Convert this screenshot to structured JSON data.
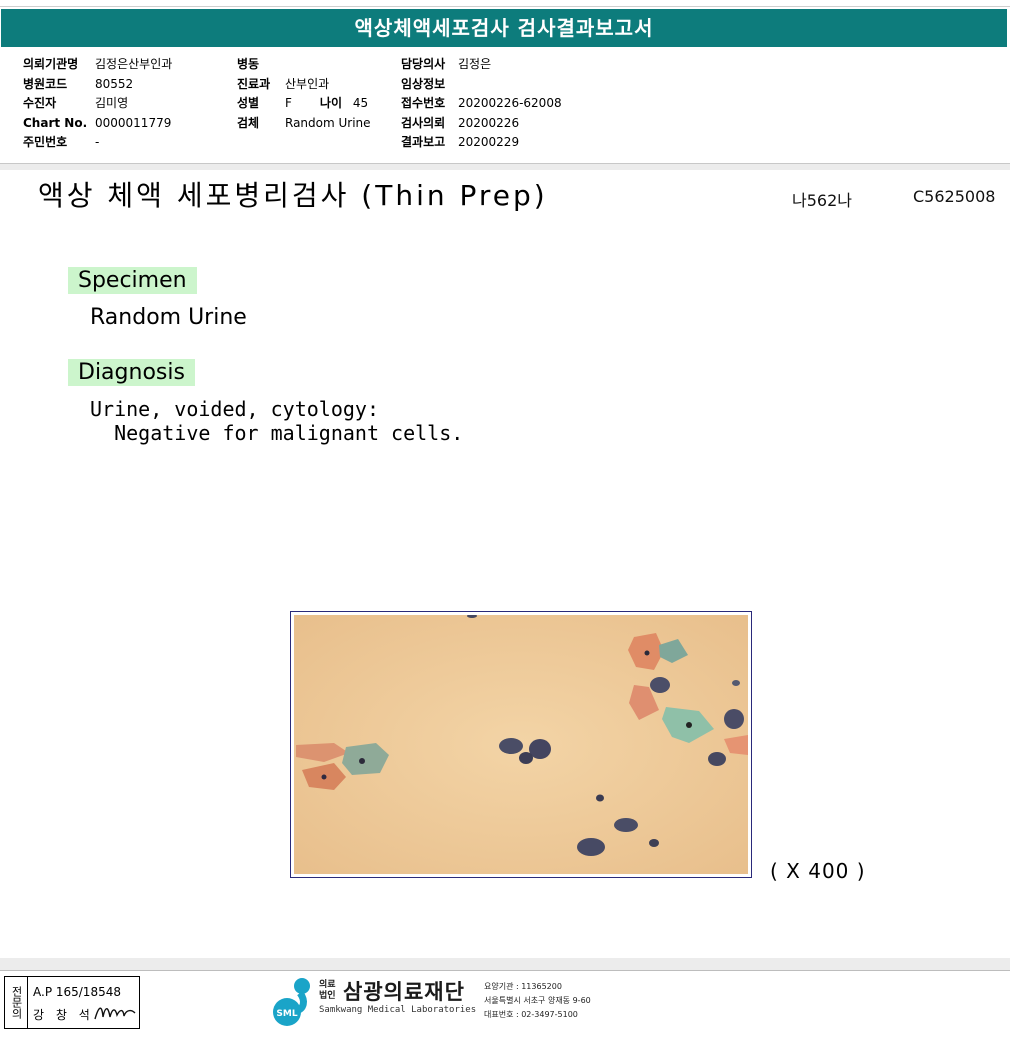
{
  "report": {
    "title": "액상체액세포검사 검사결과보고서"
  },
  "patient": {
    "col1": [
      {
        "label": "의뢰기관명",
        "value": "김정은산부인과"
      },
      {
        "label": "병원코드",
        "value": "80552"
      },
      {
        "label": "수진자",
        "value": "김미영"
      },
      {
        "label": "Chart No.",
        "value": "0000011779"
      },
      {
        "label": "주민번호",
        "value": "-"
      }
    ],
    "col2": [
      {
        "label": "병동",
        "value": ""
      },
      {
        "label": "진료과",
        "value": "산부인과"
      },
      {
        "label": "성별",
        "value": "F"
      },
      {
        "label": "검체",
        "value": "Random Urine"
      }
    ],
    "age": {
      "label": "나이",
      "value": "45"
    },
    "col3": [
      {
        "label": "담당의사",
        "value": "김정은"
      },
      {
        "label": "임상정보",
        "value": ""
      },
      {
        "label": "접수번호",
        "value": "20200226-62008"
      },
      {
        "label": "검사의뢰",
        "value": "20200226"
      },
      {
        "label": "결과보고",
        "value": "20200229"
      }
    ]
  },
  "exam": {
    "title": "액상 체액 세포병리검사 (Thin Prep)",
    "code_1": "나562나",
    "code_2": "C5625008"
  },
  "specimen": {
    "label": "Specimen",
    "value": "Random Urine"
  },
  "diagnosis": {
    "label": "Diagnosis",
    "line_1": "Urine, voided, cytology:",
    "line_2": "  Negative for malignant cells."
  },
  "micrograph": {
    "magnification": "( X 400 )"
  },
  "signature": {
    "side_label": "전문의",
    "ap_number": "A.P 165/18548",
    "name": "강 창 석"
  },
  "organization": {
    "logo_text": "SML",
    "prefix": "의료법인",
    "name": "삼광의료재단",
    "english_name": "Samkwang Medical Laboratories",
    "info_lines": [
      "요양기관 : 11365200",
      "서울특별시 서초구 양재동 9-60",
      "대표번호 : 02-3497-5100"
    ]
  },
  "colors": {
    "title_bar": "#0d7c7c",
    "section_highlight": "#ccf5cc",
    "logo": "#1aa4c8"
  }
}
